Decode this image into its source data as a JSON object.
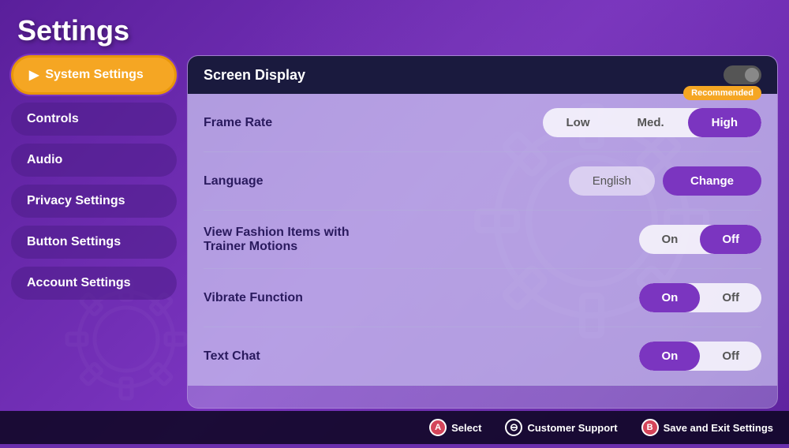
{
  "page": {
    "title": "Settings"
  },
  "sidebar": {
    "items": [
      {
        "id": "system-settings",
        "label": "System Settings",
        "active": true
      },
      {
        "id": "controls",
        "label": "Controls",
        "active": false
      },
      {
        "id": "audio",
        "label": "Audio",
        "active": false
      },
      {
        "id": "privacy-settings",
        "label": "Privacy Settings",
        "active": false
      },
      {
        "id": "button-settings",
        "label": "Button Settings",
        "active": false
      },
      {
        "id": "account-settings",
        "label": "Account Settings",
        "active": false
      }
    ]
  },
  "main": {
    "section_title": "Screen Display",
    "settings": [
      {
        "id": "frame-rate",
        "label": "Frame Rate",
        "type": "three-toggle",
        "options": [
          "Low",
          "Med.",
          "High"
        ],
        "selected": "High",
        "recommended": "Recommended",
        "recommended_on": "High"
      },
      {
        "id": "language",
        "label": "Language",
        "type": "language",
        "current_value": "English",
        "button_label": "Change"
      },
      {
        "id": "fashion-items",
        "label": "View Fashion Items with\nTrainer Motions",
        "type": "on-off",
        "selected": "Off"
      },
      {
        "id": "vibrate-function",
        "label": "Vibrate Function",
        "type": "on-off",
        "selected": "On"
      },
      {
        "id": "text-chat",
        "label": "Text Chat",
        "type": "on-off",
        "selected": "On"
      }
    ]
  },
  "bottom_bar": {
    "actions": [
      {
        "id": "select",
        "icon": "A",
        "label": "Select",
        "icon_type": "a"
      },
      {
        "id": "customer-support",
        "icon": "−",
        "label": "Customer Support",
        "icon_type": "minus"
      },
      {
        "id": "save-exit",
        "icon": "B",
        "label": "Save and Exit Settings",
        "icon_type": "b"
      }
    ]
  }
}
